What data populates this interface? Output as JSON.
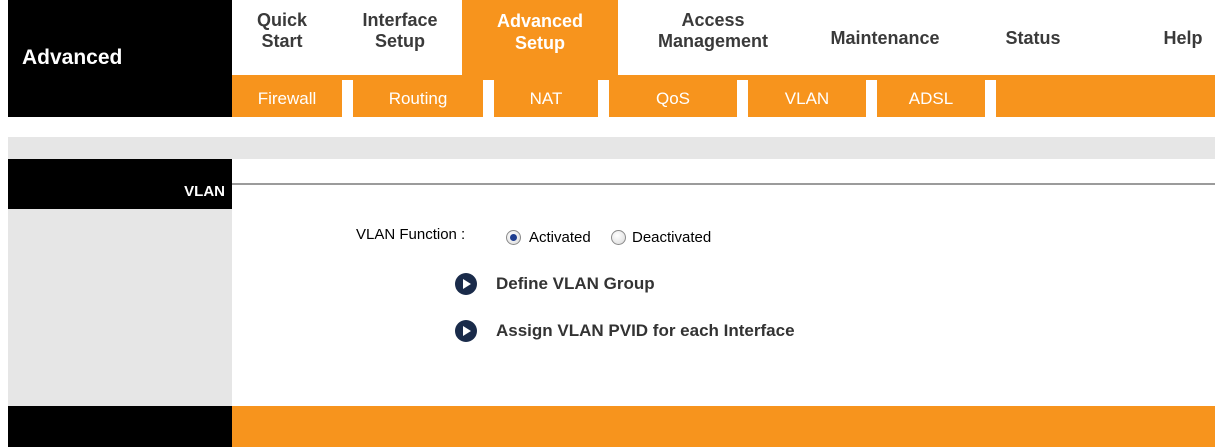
{
  "brand": {
    "title": "Advanced"
  },
  "nav": {
    "quick_start": [
      "Quick",
      "Start"
    ],
    "interface_setup": [
      "Interface",
      "Setup"
    ],
    "advanced_setup": [
      "Advanced",
      "Setup"
    ],
    "access_management": [
      "Access",
      "Management"
    ],
    "maintenance": "Maintenance",
    "status": "Status",
    "help": "Help"
  },
  "subnav": [
    "Firewall",
    "Routing",
    "NAT",
    "QoS",
    "VLAN",
    "ADSL"
  ],
  "sidebar": {
    "section": "VLAN"
  },
  "content": {
    "function_label": "VLAN Function :",
    "options": [
      {
        "label": "Activated",
        "selected": true
      },
      {
        "label": "Deactivated",
        "selected": false
      }
    ],
    "links": [
      "Define VLAN Group",
      "Assign VLAN PVID for each Interface"
    ]
  },
  "colors": {
    "accent": "#f7941d",
    "dark": "#000000",
    "panel": "#e6e6e6",
    "link_icon": "#1a2b4a"
  }
}
